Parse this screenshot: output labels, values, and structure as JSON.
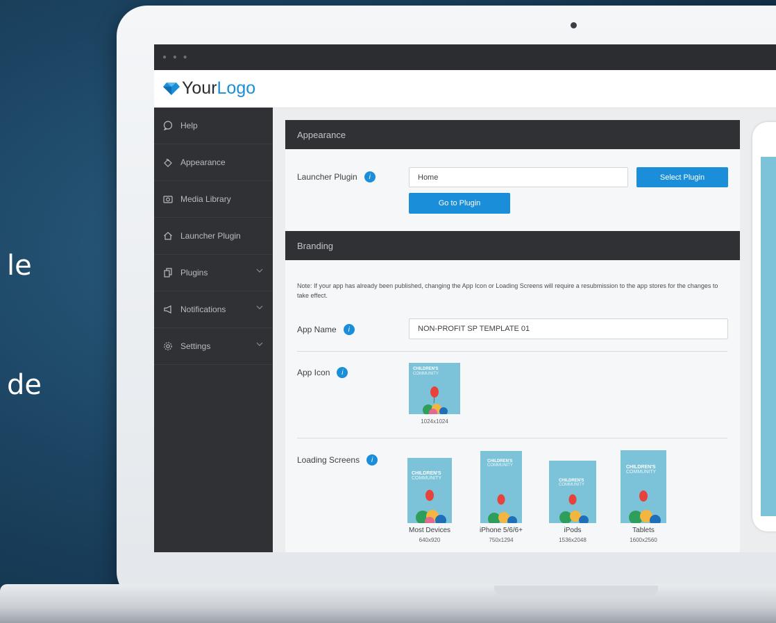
{
  "background_text": {
    "line1": "le",
    "line2": "de"
  },
  "logo": {
    "your": "Your",
    "logo": "Logo"
  },
  "sidebar": {
    "items": [
      {
        "label": "Help",
        "icon": "help-bubble-icon"
      },
      {
        "label": "Appearance",
        "icon": "paint-bucket-icon"
      },
      {
        "label": "Media Library",
        "icon": "camera-icon"
      },
      {
        "label": "Launcher Plugin",
        "icon": "home-icon"
      },
      {
        "label": "Plugins",
        "icon": "plugins-icon",
        "expandable": true
      },
      {
        "label": "Notifications",
        "icon": "megaphone-icon",
        "expandable": true
      },
      {
        "label": "Settings",
        "icon": "gear-icon",
        "expandable": true
      }
    ]
  },
  "appearance": {
    "header": "Appearance",
    "launcher_label": "Launcher Plugin",
    "launcher_value": "Home",
    "select_plugin": "Select Plugin",
    "go_to_plugin": "Go to Plugin"
  },
  "branding": {
    "header": "Branding",
    "note": "Note: If your app has already been published, changing the App Icon or Loading Screens will require a resubmission to the app stores for the changes to take effect.",
    "app_name_label": "App Name",
    "app_name_value": "NON-PROFIT SP TEMPLATE 01",
    "app_icon_label": "App Icon",
    "app_icon_size": "1024x1024",
    "loading_label": "Loading Screens",
    "screens": [
      {
        "name": "Most Devices",
        "size": "640x920"
      },
      {
        "name": "iPhone 5/6/6+",
        "size": "750x1294"
      },
      {
        "name": "iPods",
        "size": "1536x2048"
      },
      {
        "name": "Tablets",
        "size": "1600x2560"
      }
    ],
    "thumb_title": "CHILDREN'S",
    "thumb_sub": "COMMUNITY"
  },
  "colors": {
    "accent": "#1a8ed8",
    "sidebar": "#2f3134",
    "thumb": "#7cc3d9"
  }
}
